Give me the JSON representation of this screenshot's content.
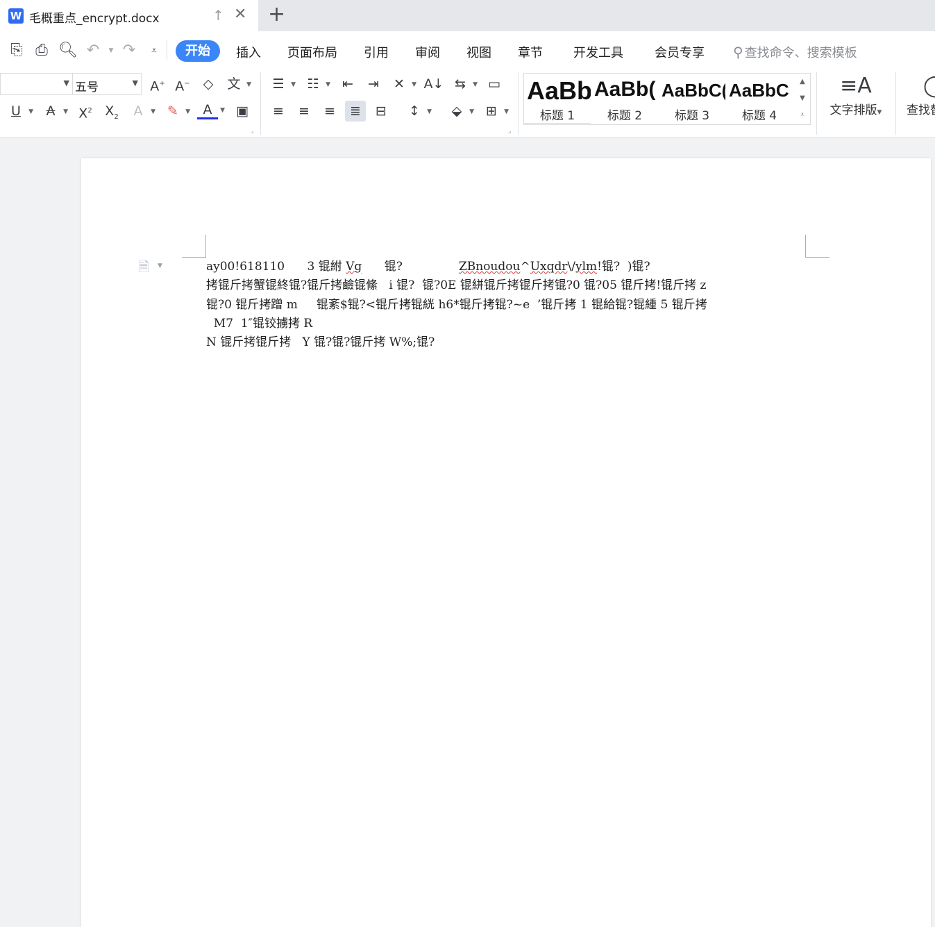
{
  "window": {
    "doc_title": "毛概重点_encrypt.docx",
    "app_icon_letter": "W"
  },
  "menu": {
    "tabs": [
      "开始",
      "插入",
      "页面布局",
      "引用",
      "审阅",
      "视图",
      "章节",
      "开发工具",
      "会员专享"
    ],
    "active_tab": "开始",
    "search_placeholder": "查找命令、搜索模板"
  },
  "ribbon": {
    "font_name": "",
    "font_size": "五号",
    "styles": [
      {
        "sample": "AaBb",
        "label": "标题 1"
      },
      {
        "sample": "AaBb(",
        "label": "标题 2"
      },
      {
        "sample": "AaBbC(",
        "label": "标题 3"
      },
      {
        "sample": "AaBbC",
        "label": "标题 4"
      }
    ],
    "text_layout_label": "文字排版",
    "find_label": "查找替"
  },
  "document": {
    "lines": [
      {
        "pre": "ay00!618110      3 锟紨 ",
        "u1": "Vg",
        "mid": "      锟?               ",
        "u2": "ZBnoudou",
        "mid2": "^",
        "u3": "Uxqdr",
        "mid3": "\\/",
        "u4": "ylm",
        "post": "!锟?  )锟?"
      },
      {
        "text": "拷锟斤拷蟹锟終锟?锟斤拷鹼锟絛   i 锟?  锟?0E 锟絣锟斤拷锟斤拷锟?0 锟?05 锟斤拷!锟斤拷 z"
      },
      {
        "text": "锟?0 锟斤拷蹭 m     锟紊$锟?<锟斤拷锟絖 h6*锟斤拷锟?~e  ’锟斤拷 1 锟給锟?锟緟 5 锟斤拷"
      },
      {
        "text": "  M7  1″锟铰擄拷 R"
      },
      {
        "text": "N 锟斤拷锟斤拷   Y 锟?锟?锟斤拷 W%;锟?"
      }
    ]
  },
  "colors": {
    "accent": "#3b86f7",
    "app_blue": "#2f6bf2",
    "spell_error": "#d63a3a"
  }
}
